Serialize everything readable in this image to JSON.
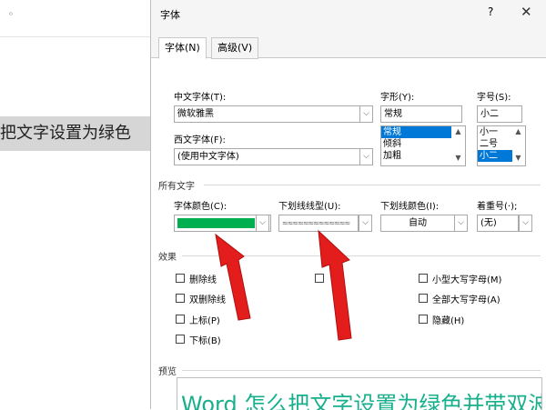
{
  "background_doc": {
    "corner_mark": "ᴳ",
    "selected_text": "把文字设置为绿色"
  },
  "dialog": {
    "title": "字体",
    "help": "?",
    "close": "✕",
    "tabs": [
      "字体(N)",
      "高级(V)"
    ],
    "chinese_font": {
      "label": "中文字体(T):",
      "value": "微软雅黑"
    },
    "western_font": {
      "label": "西文字体(F):",
      "value": "(使用中文字体)"
    },
    "style": {
      "label": "字形(Y):",
      "value": "常规",
      "options": [
        "常规",
        "倾斜",
        "加粗"
      ],
      "selected": "常规"
    },
    "size": {
      "label": "字号(S):",
      "value": "小二",
      "options": [
        "小一",
        "二号",
        "小二"
      ],
      "selected": "小二"
    },
    "all_text": {
      "section": "所有文字",
      "font_color": {
        "label": "字体颜色(C):",
        "color": "#00b050"
      },
      "underline_style": {
        "label": "下划线线型(U):",
        "value": "≈≈≈≈≈≈≈≈≈≈≈≈≈"
      },
      "underline_color": {
        "label": "下划线颜色(I):",
        "value": "自动"
      },
      "emphasis": {
        "label": "着重号(·);",
        "value": "(无)"
      }
    },
    "effects": {
      "section": "效果",
      "left": [
        "删除线",
        "双删除线",
        "上标(P)",
        "下标(B)"
      ],
      "right": [
        "小型大写字母(M)",
        "全部大写字母(A)",
        "隐藏(H)"
      ]
    },
    "preview": {
      "section": "预览",
      "text": "Word 怎么把文字设置为绿色并带双波浪"
    }
  },
  "annotation": {
    "arrow_color": "#e31c1c"
  }
}
